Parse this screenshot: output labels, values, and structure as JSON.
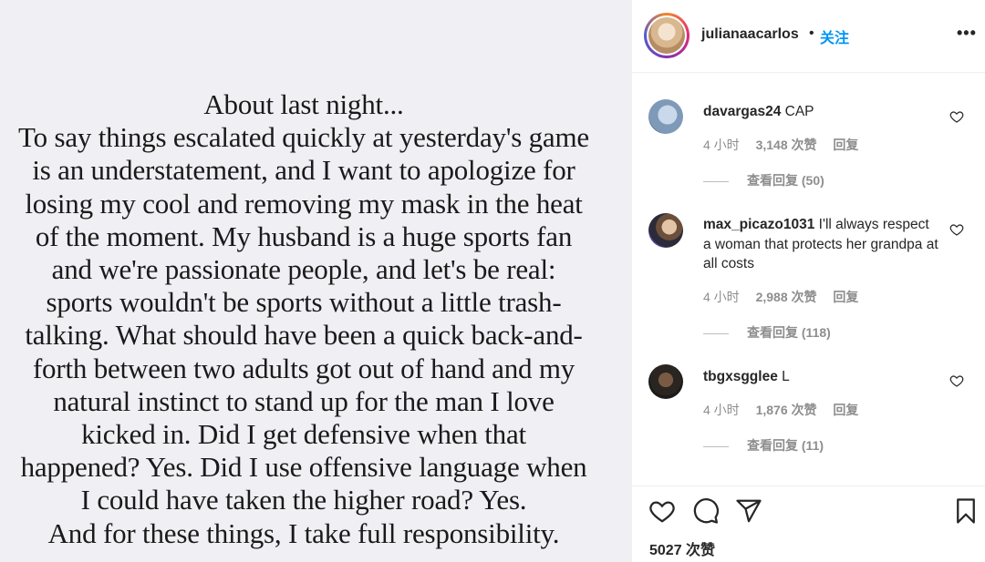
{
  "post": {
    "image_text_lines": [
      "About last night...",
      "To say things escalated quickly at yesterday's game",
      "is an understatement, and I want to apologize for",
      "losing my cool and removing my mask in the heat",
      "of the moment. My husband is a huge sports fan",
      "and we're passionate people, and let's be real:",
      "sports wouldn't be sports without a little trash-",
      "talking. What should have been a quick back-and-",
      "forth between two adults got out of hand and my",
      "natural instinct to stand up for the man I love",
      "kicked in. Did I get defensive when that",
      "happened? Yes. Did I use offensive language when",
      "I could have taken the higher road? Yes.",
      "And for these things, I take full responsibility."
    ]
  },
  "header": {
    "username": "julianaacarlos",
    "separator": "•",
    "follow_label": "关注",
    "more_label": "•••"
  },
  "comments": [
    {
      "username": "davargas24",
      "text": "CAP",
      "time": "4 小时",
      "likes": "3,148 次赞",
      "reply_label": "回复",
      "view_replies": "查看回复 (50)"
    },
    {
      "username": "max_picazo1031",
      "text": "I'll always respect a woman that protects her grandpa at all costs",
      "time": "4 小时",
      "likes": "2,988 次赞",
      "reply_label": "回复",
      "view_replies": "查看回复 (118)"
    },
    {
      "username": "tbgxsgglee",
      "text": "L",
      "time": "4 小时",
      "likes": "1,876 次赞",
      "reply_label": "回复",
      "view_replies": "查看回复 (11)"
    }
  ],
  "footer": {
    "likes_count": "5027 次赞"
  },
  "icons": {
    "like": "heart-icon",
    "comment": "comment-bubble-icon",
    "share": "paper-plane-icon",
    "save": "bookmark-icon",
    "more": "more-dots-icon"
  },
  "colors": {
    "accent": "#0095f6",
    "muted": "#8e8e8e",
    "image_bg": "#efeff4"
  }
}
